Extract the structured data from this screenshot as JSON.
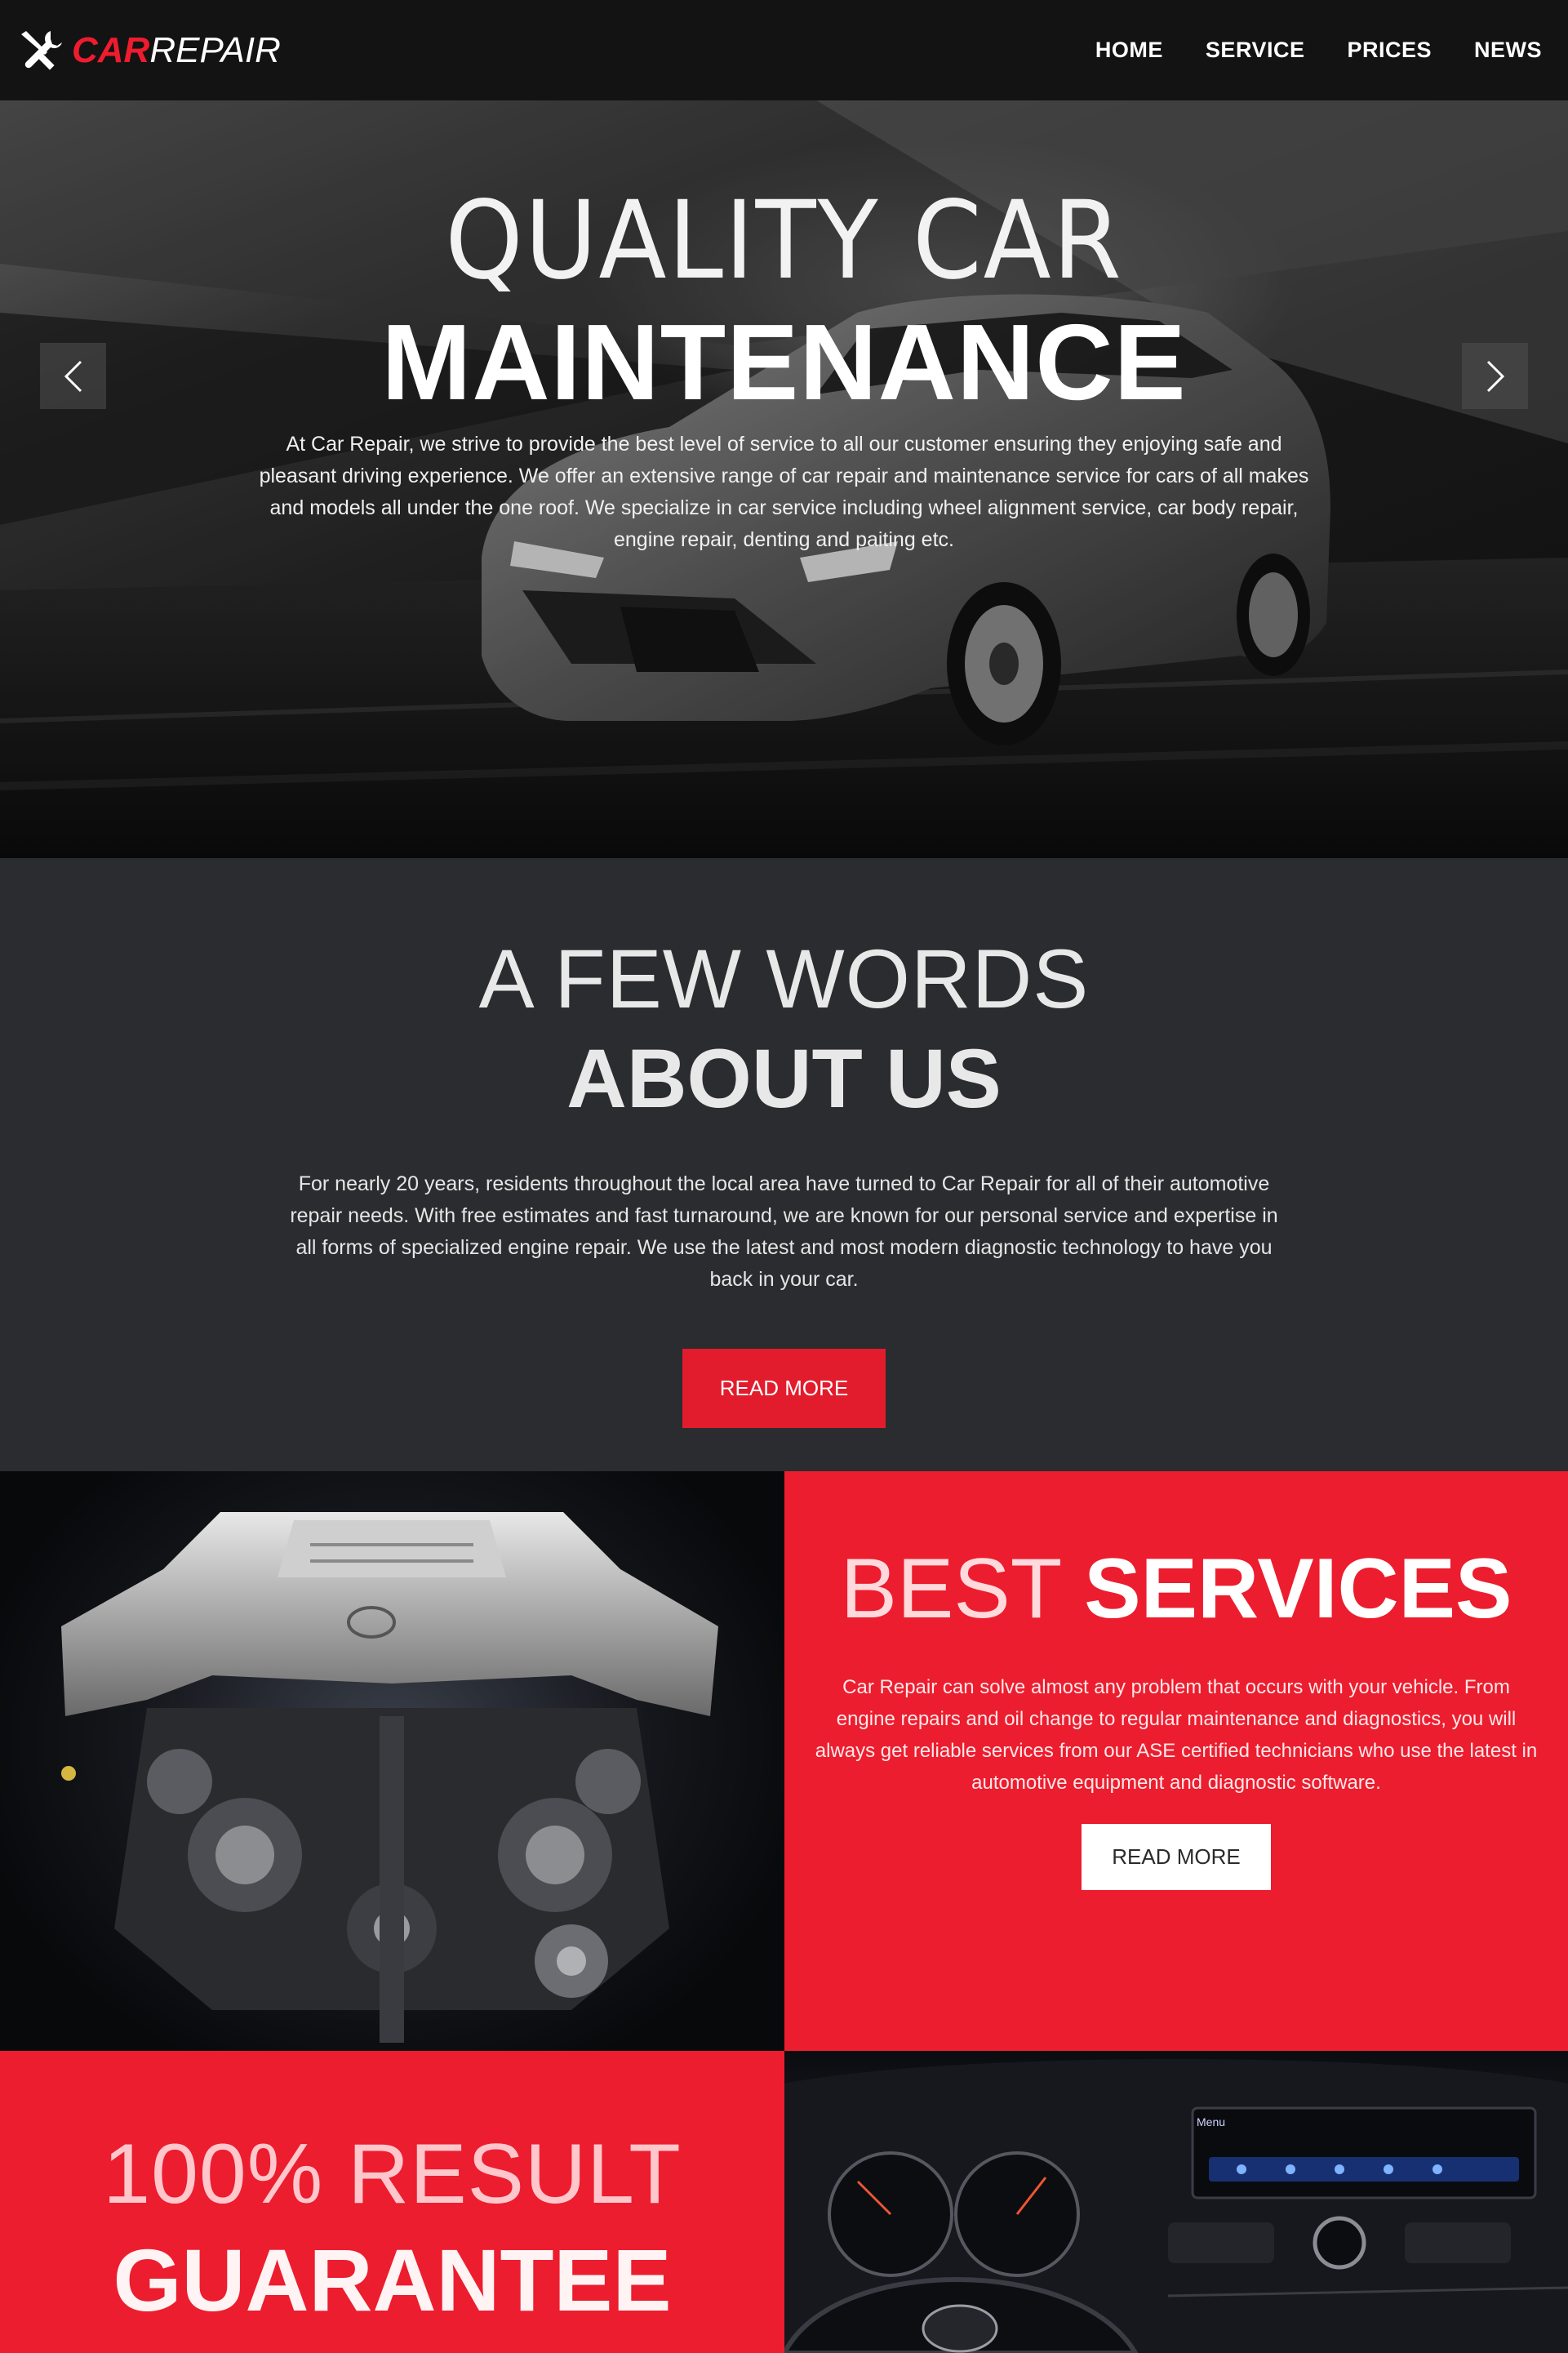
{
  "brand": {
    "car": "CAR",
    "repair": "REPAIR"
  },
  "nav": {
    "items": [
      "HOME",
      "SERVICE",
      "PRICES",
      "NEWS"
    ]
  },
  "hero": {
    "title_light": "QUALITY CAR",
    "title_bold": "MAINTENANCE",
    "text": "At Car Repair, we strive to provide the best level of service to all our customer ensuring they enjoying safe and pleasant driving experience. We offer an extensive range of car repair and maintenance service for cars of all makes and models all under the one roof. We specialize in car service including wheel alignment service, car body repair, engine repair, denting and paiting etc."
  },
  "about": {
    "title_light": "A FEW WORDS",
    "title_bold": "ABOUT US",
    "text": "For nearly 20 years, residents throughout the local area have turned to Car Repair for all of their automotive repair needs. With free estimates and fast turnaround, we are known for our personal service and expertise in all forms of specialized engine repair. We use the latest and most modern diagnostic technology to have you back in your car.",
    "button": "READ MORE"
  },
  "services": {
    "title_light": "BEST",
    "title_bold": "SERVICES",
    "text": "Car Repair can solve almost any problem that occurs with your vehicle. From engine repairs and oil change to regular maintenance and diagnostics, you will always get reliable services from our ASE certified technicians who use the latest in automotive equipment and diagnostic software.",
    "button": "READ MORE"
  },
  "guarantee": {
    "title_light": "100% RESULT",
    "title_bold": "GUARANTEE"
  },
  "dash": {
    "screen_label": "Menu"
  },
  "colors": {
    "accent": "#ec1d2e",
    "dark": "#2b2c2f",
    "nav": "#131313"
  }
}
